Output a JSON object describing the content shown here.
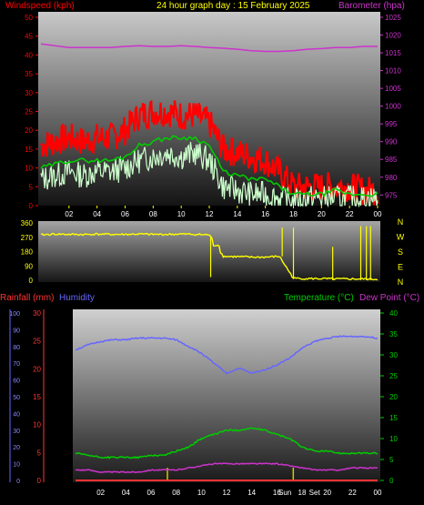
{
  "header": {
    "windspeed_label": "Windspeed (kph)",
    "title": "24 hour graph day : 15 February 2025",
    "barometer_label": "Barometer (hpa)"
  },
  "colors": {
    "background": "#000000",
    "windspeed": "#ff0000",
    "title": "#ffff00",
    "barometer": "#cc33cc",
    "gust": "#ff0000",
    "avg_wind": "#00cc00",
    "wind_trace": "#ccffcc",
    "wind_dir": "#ffff00",
    "rainfall": "#ff3333",
    "humidity": "#6666ff",
    "temperature": "#00cc00",
    "dew_point": "#cc33cc",
    "sunrise_marker": "#cccc00",
    "hour_ticks": "#ffff00"
  },
  "chart_data": [
    {
      "id": "wind_baro",
      "type": "line",
      "x_hours": [
        0,
        1,
        2,
        3,
        4,
        5,
        6,
        7,
        8,
        9,
        10,
        11,
        12,
        13,
        14,
        15,
        16,
        17,
        18,
        19,
        20,
        21,
        22,
        23,
        24
      ],
      "x_tick_labels": [
        "02",
        "04",
        "06",
        "08",
        "10",
        "12",
        "14",
        "16",
        "18",
        "20",
        "22",
        "00"
      ],
      "left_axis": {
        "label": "Windspeed (kph)",
        "ylim": [
          0,
          50
        ],
        "ticks": [
          0,
          5,
          10,
          15,
          20,
          25,
          30,
          35,
          40,
          45,
          50
        ]
      },
      "right_axis": {
        "label": "Barometer (hpa)",
        "ylim": [
          972,
          1025
        ],
        "ticks": [
          975,
          980,
          985,
          990,
          995,
          1000,
          1005,
          1010,
          1015,
          1020,
          1025
        ]
      },
      "series": [
        {
          "role": "gust",
          "axis": "left",
          "values": [
            16,
            17,
            18,
            17,
            18,
            18,
            20,
            24,
            25,
            25,
            24,
            24,
            22,
            15,
            14,
            13,
            12,
            9,
            5,
            5,
            5,
            5,
            5,
            4,
            4
          ]
        },
        {
          "role": "average",
          "axis": "left",
          "values": [
            10,
            11,
            12,
            12,
            12,
            12,
            13,
            16,
            17,
            18,
            18,
            18,
            16,
            9,
            8,
            7,
            7,
            5,
            3,
            3,
            3,
            4,
            3,
            3,
            3
          ]
        },
        {
          "role": "trace",
          "axis": "left",
          "values": [
            7,
            8,
            9,
            8,
            9,
            9,
            10,
            12,
            13,
            14,
            13,
            14,
            12,
            5,
            4,
            3,
            3,
            2,
            1,
            2,
            2,
            2,
            2,
            2,
            2
          ]
        },
        {
          "role": "barometer",
          "axis": "right",
          "values": [
            1017.5,
            1017,
            1016.5,
            1016.5,
            1016.5,
            1016.5,
            1016.8,
            1017,
            1016.8,
            1016.8,
            1017,
            1016.8,
            1016.5,
            1016.3,
            1016,
            1015.6,
            1015.4,
            1015.4,
            1015.6,
            1016,
            1016.2,
            1016.5,
            1016.5,
            1016.8,
            1016.8
          ]
        }
      ]
    },
    {
      "id": "wind_direction",
      "type": "line",
      "left_axis": {
        "ylim": [
          0,
          360
        ],
        "ticks": [
          0,
          90,
          180,
          270,
          360
        ]
      },
      "compass_labels": [
        "N",
        "W",
        "S",
        "E",
        "N"
      ],
      "series": [
        {
          "role": "direction",
          "x_hours": [
            0,
            1,
            2,
            3,
            4,
            5,
            6,
            7,
            8,
            9,
            10,
            11,
            12,
            13,
            14,
            15,
            16,
            17,
            18,
            19,
            20,
            21,
            22,
            23,
            24
          ],
          "values": [
            285,
            290,
            288,
            287,
            290,
            288,
            288,
            290,
            288,
            288,
            290,
            288,
            285,
            150,
            148,
            145,
            145,
            150,
            12,
            10,
            10,
            8,
            8,
            8,
            6
          ]
        }
      ]
    },
    {
      "id": "temp_hum_rain",
      "type": "line",
      "x_hours": [
        0,
        1,
        2,
        3,
        4,
        5,
        6,
        7,
        8,
        9,
        10,
        11,
        12,
        13,
        14,
        15,
        16,
        17,
        18,
        19,
        20,
        21,
        22,
        23,
        24
      ],
      "x_tick_labels": [
        "02",
        "04",
        "06",
        "08",
        "10",
        "12",
        "14",
        "16",
        "Sun",
        "18",
        "Set",
        "20",
        "22",
        "00"
      ],
      "header": {
        "rainfall_label": "Rainfall (mm)",
        "humidity_label": "Humidity",
        "temperature_label": "Temperature (°C)",
        "dew_point_label": "Dew Point (°C)"
      },
      "humidity_axis": {
        "ylim": [
          0,
          100
        ],
        "ticks": [
          0,
          10,
          20,
          30,
          40,
          50,
          60,
          70,
          80,
          90,
          100
        ]
      },
      "rain_axis": {
        "ylim": [
          0,
          30
        ],
        "ticks": [
          0,
          5,
          10,
          15,
          20,
          25,
          30
        ]
      },
      "temp_axis": {
        "ylim": [
          0,
          40
        ],
        "ticks": [
          0,
          5,
          10,
          15,
          20,
          25,
          30,
          35,
          40
        ]
      },
      "series": [
        {
          "role": "humidity",
          "axis": "humidity",
          "values": [
            78,
            81,
            83,
            84,
            84,
            85,
            85,
            85,
            84,
            80,
            76,
            70,
            64,
            67,
            64,
            66,
            69,
            73,
            79,
            83,
            85,
            86,
            86,
            86,
            85
          ]
        },
        {
          "role": "temperature",
          "axis": "temp",
          "values": [
            6.5,
            6,
            5.5,
            5.5,
            5.5,
            5.5,
            6,
            6,
            7,
            8,
            10,
            11,
            12,
            12,
            12.5,
            12,
            11,
            10,
            8,
            7,
            7,
            6.5,
            6.5,
            6.5,
            6.5
          ]
        },
        {
          "role": "dew_point",
          "axis": "temp",
          "values": [
            2.5,
            2.5,
            2,
            2,
            2,
            2,
            2.5,
            2.5,
            2.5,
            3,
            3.5,
            4,
            4,
            4,
            4,
            4,
            4,
            3.5,
            3,
            2.5,
            2.5,
            2.5,
            3,
            3,
            3
          ]
        },
        {
          "role": "rainfall",
          "axis": "rain",
          "values": [
            0,
            0,
            0,
            0,
            0,
            0,
            0,
            0,
            0,
            0,
            0,
            0,
            0,
            0,
            0,
            0,
            0,
            0,
            0,
            0,
            0,
            0,
            0,
            0,
            0
          ]
        }
      ],
      "markers": [
        {
          "label": "Sun",
          "hour": 7.3
        },
        {
          "label": "Set",
          "hour": 17.3
        }
      ]
    }
  ]
}
